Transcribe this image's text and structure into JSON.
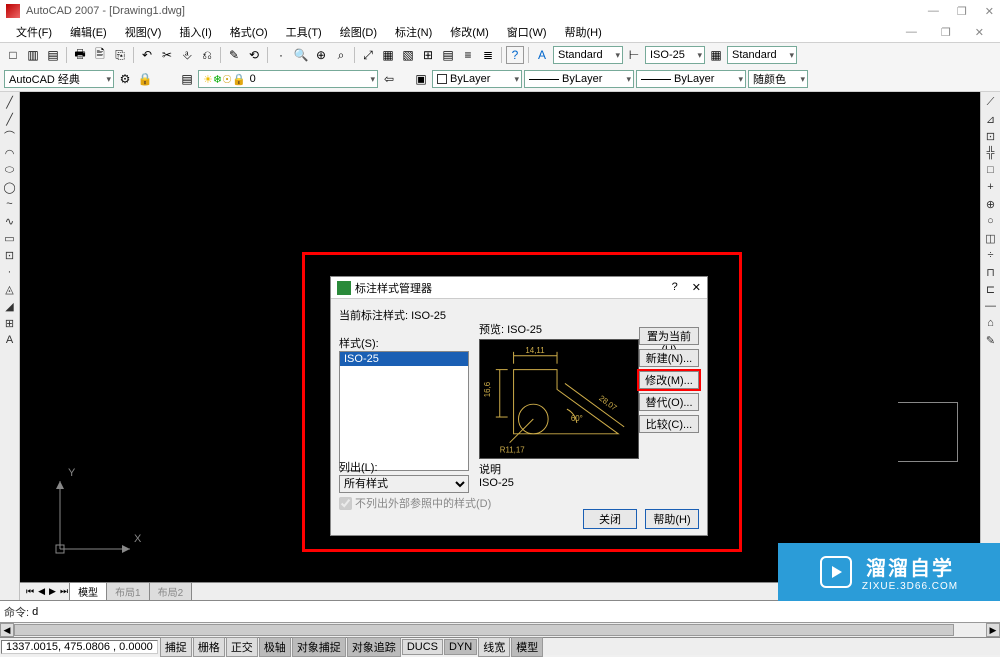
{
  "window": {
    "title": "AutoCAD 2007 - [Drawing1.dwg]",
    "controls": {
      "min": "—",
      "max": "❐",
      "close": "✕"
    },
    "sub_controls": {
      "min": "—",
      "max": "❐",
      "close": "✕"
    }
  },
  "menu": [
    "文件(F)",
    "编辑(E)",
    "视图(V)",
    "插入(I)",
    "格式(O)",
    "工具(T)",
    "绘图(D)",
    "标注(N)",
    "修改(M)",
    "窗口(W)",
    "帮助(H)"
  ],
  "toolbar1_icons": [
    "□",
    "▥",
    "▤",
    "🖶",
    "🖹",
    "⎘",
    "↶",
    "✂",
    "⎀",
    "⎌",
    "✎",
    "⟲",
    "⟳",
    "·",
    "🔍",
    "⊕",
    "⌕",
    "⤢",
    "▦",
    "▧",
    "⊞",
    "▤",
    "≡",
    "≣",
    "🖩",
    "?"
  ],
  "toolbar1_styles": {
    "text_style": "Standard",
    "dim_style": "ISO-25",
    "table_style": "Standard"
  },
  "toolbar2": {
    "workspace": "AutoCAD 经典",
    "layer": "0",
    "bylayer1": "ByLayer",
    "bylayer2": "ByLayer",
    "bylayer3": "ByLayer",
    "color": "随颜色"
  },
  "left_tools": [
    "╱",
    "╱",
    "⌒",
    "◠",
    "⬭",
    "◯",
    "~",
    "∿",
    "▭",
    "⊡",
    "·",
    "◬",
    "◢",
    "⊞",
    "A"
  ],
  "right_tools": [
    "⟋",
    "⊿",
    "⊡",
    "╬",
    "□",
    "+",
    "⊕",
    "○",
    "◫",
    "÷",
    "⊓",
    "⊏",
    "—",
    "⌂",
    "✎"
  ],
  "tabs": {
    "nav": {
      "first": "⏮",
      "prev": "◀",
      "next": "▶",
      "last": "⏭"
    },
    "items": [
      "模型",
      "布局1",
      "布局2"
    ],
    "active": 0
  },
  "command": {
    "prompt": "命令:",
    "value": "d"
  },
  "status": {
    "coords": "1337.0015, 475.0806 , 0.0000",
    "buttons": [
      "捕捉",
      "栅格",
      "正交",
      "极轴",
      "对象捕捉",
      "对象追踪",
      "DUCS",
      "DYN",
      "线宽",
      "模型"
    ]
  },
  "dialog": {
    "title": "标注样式管理器",
    "help": "?",
    "close_x": "✕",
    "current_label": "当前标注样式:",
    "current_style": "ISO-25",
    "styles_label": "样式(S):",
    "styles": [
      "ISO-25"
    ],
    "list_label": "列出(L):",
    "list_value": "所有样式",
    "xref_label": "不列出外部参照中的样式(D)",
    "preview_label": "预览:",
    "preview_style": "ISO-25",
    "desc_label": "说明",
    "desc_value": "ISO-25",
    "preview_dims": {
      "top": "14,11",
      "left": "16,6",
      "diag_angle": "60°",
      "diag_len": "28,07",
      "radius": "R11,17"
    },
    "buttons": {
      "set_current": "置为当前(U)",
      "new": "新建(N)...",
      "modify": "修改(M)...",
      "override": "替代(O)...",
      "compare": "比较(C)..."
    },
    "close": "关闭",
    "help_btn": "帮助(H)"
  },
  "ucs": {
    "x": "X",
    "y": "Y"
  },
  "watermark": {
    "title": "溜溜自学",
    "url": "ZIXUE.3D66.COM"
  }
}
